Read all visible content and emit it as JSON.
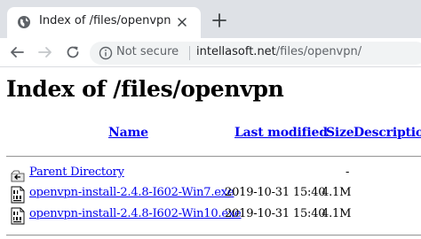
{
  "browser": {
    "tab": {
      "title": "Index of /files/openvpn"
    },
    "address_bar": {
      "security_label": "Not secure",
      "url_host": "intellasoft.net",
      "url_path": "/files/openvpn/"
    }
  },
  "page": {
    "heading": "Index of /files/openvpn",
    "columns": {
      "name": "Name",
      "last_modified": "Last modified",
      "size": "Size",
      "description": "Description"
    },
    "entries": [
      {
        "name": "Parent Directory",
        "modified": "",
        "size": "-",
        "icon": "back-folder-icon"
      },
      {
        "name": "openvpn-install-2.4.8-I602-Win7.exe",
        "modified": "2019-10-31 15:40",
        "size": "4.1M",
        "icon": "binary-file-icon"
      },
      {
        "name": "openvpn-install-2.4.8-I602-Win10.exe",
        "modified": "2019-10-31 15:40",
        "size": "4.1M",
        "icon": "binary-file-icon"
      }
    ]
  },
  "colors": {
    "link": "#0000ee",
    "tabstrip": "#dee1e6",
    "omnibox": "#f1f3f4"
  }
}
